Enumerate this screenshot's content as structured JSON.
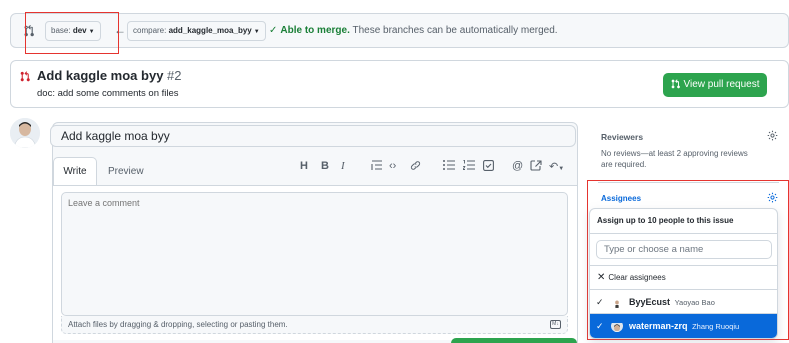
{
  "compare": {
    "base_prefix": "base:",
    "base_branch": "dev",
    "compare_prefix": "compare:",
    "compare_branch": "add_kaggle_moa_byy",
    "merge_ok": "Able to merge.",
    "merge_detail": "These branches can be automatically merged."
  },
  "pull_request": {
    "title": "Add kaggle moa byy",
    "number": "#2",
    "description": "doc: add some comments on files",
    "view_button": "View pull request"
  },
  "editor": {
    "title_value": "Add kaggle moa byy",
    "tab_write": "Write",
    "tab_preview": "Preview",
    "comment_placeholder": "Leave a comment",
    "attach_hint": "Attach files by dragging & dropping, selecting or pasting them.",
    "toolbar_icons": [
      "heading-icon",
      "bold-icon",
      "italic-icon",
      "quote-icon",
      "code-icon",
      "link-icon",
      "unordered-list-icon",
      "ordered-list-icon",
      "task-list-icon",
      "mention-icon",
      "cross-reference-icon",
      "reply-icon"
    ]
  },
  "sidebar": {
    "reviewers_heading": "Reviewers",
    "reviewers_text": "No reviews—at least 2 approving reviews are required.",
    "assignees_heading": "Assignees"
  },
  "assignee_dropdown": {
    "header": "Assign up to 10 people to this issue",
    "search_placeholder": "Type or choose a name",
    "clear_label": "Clear assignees",
    "people": [
      {
        "login": "ByyEcust",
        "name": "Yaoyao Bao",
        "selected": false
      },
      {
        "login": "waterman-zrq",
        "name": "Zhang Ruoqiu",
        "selected": true
      }
    ]
  },
  "colors": {
    "accent_green": "#2da44e",
    "accent_blue": "#0969da",
    "highlight_red": "#e5342f"
  }
}
